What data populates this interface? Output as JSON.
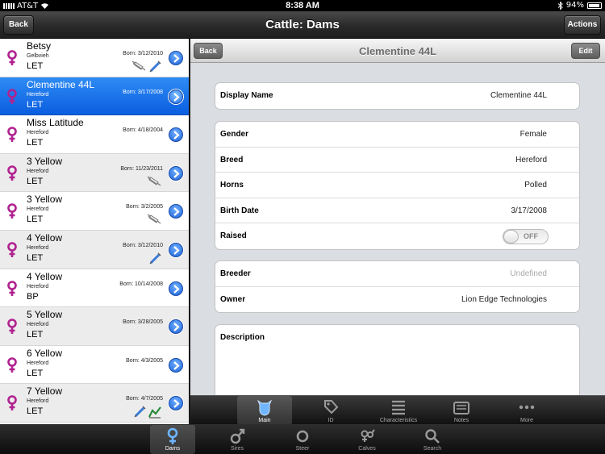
{
  "status": {
    "carrier": "AT&T",
    "time": "8:38 AM",
    "battery": "94%"
  },
  "nav": {
    "title": "Cattle: Dams",
    "back_label": "Back",
    "actions_label": "Actions"
  },
  "list": [
    {
      "name": "Betsy",
      "breed": "Gelbvieh",
      "born": "Born: 3/12/2010",
      "code": "LET",
      "icons": [
        "syringe-icon",
        "needle-icon"
      ],
      "selected": false,
      "alt": false
    },
    {
      "name": "Clementine 44L",
      "breed": "Hereford",
      "born": "Born: 3/17/2008",
      "code": "LET",
      "icons": [],
      "selected": true,
      "alt": false
    },
    {
      "name": "Miss Latitude",
      "breed": "Hereford",
      "born": "Born: 4/18/2004",
      "code": "LET",
      "icons": [],
      "selected": false,
      "alt": false
    },
    {
      "name": "3 Yellow",
      "breed": "Hereford",
      "born": "Born: 11/23/2011",
      "code": "LET",
      "icons": [
        "syringe-icon"
      ],
      "selected": false,
      "alt": true
    },
    {
      "name": "3 Yellow",
      "breed": "Hereford",
      "born": "Born: 3/2/2005",
      "code": "LET",
      "icons": [
        "syringe-icon"
      ],
      "selected": false,
      "alt": false
    },
    {
      "name": "4 Yellow",
      "breed": "Hereford",
      "born": "Born: 3/12/2010",
      "code": "LET",
      "icons": [
        "needle-icon"
      ],
      "selected": false,
      "alt": true
    },
    {
      "name": "4 Yellow",
      "breed": "Hereford",
      "born": "Born: 10/14/2008",
      "code": "BP",
      "icons": [],
      "selected": false,
      "alt": false
    },
    {
      "name": "5 Yellow",
      "breed": "Hereford",
      "born": "Born: 3/28/2005",
      "code": "LET",
      "icons": [],
      "selected": false,
      "alt": true
    },
    {
      "name": "6 Yellow",
      "breed": "Hereford",
      "born": "Born: 4/3/2005",
      "code": "LET",
      "icons": [],
      "selected": false,
      "alt": false
    },
    {
      "name": "7 Yellow",
      "breed": "Hereford",
      "born": "Born: 4/7/2005",
      "code": "LET",
      "icons": [
        "needle-icon",
        "chart-icon"
      ],
      "selected": false,
      "alt": true
    }
  ],
  "detail": {
    "back_label": "Back",
    "title": "Clementine 44L",
    "edit_label": "Edit",
    "display_name_label": "Display Name",
    "display_name": "Clementine 44L",
    "gender_label": "Gender",
    "gender": "Female",
    "breed_label": "Breed",
    "breed": "Hereford",
    "horns_label": "Horns",
    "horns": "Polled",
    "birth_label": "Birth Date",
    "birth": "3/17/2008",
    "raised_label": "Raised",
    "raised_toggle": "OFF",
    "breeder_label": "Breeder",
    "breeder": "Undefined",
    "owner_label": "Owner",
    "owner": "Lion Edge Technologies",
    "description_label": "Description"
  },
  "inner_tabs": [
    {
      "label": "Main",
      "icon": "cow-head-icon",
      "active": true
    },
    {
      "label": "ID",
      "icon": "tag-icon",
      "active": false
    },
    {
      "label": "Characteristics",
      "icon": "list-icon",
      "active": false
    },
    {
      "label": "Notes",
      "icon": "notes-icon",
      "active": false
    },
    {
      "label": "More",
      "icon": "more-icon",
      "active": false
    }
  ],
  "bottom_tabs": [
    {
      "label": "Dams",
      "icon": "female-icon",
      "active": true
    },
    {
      "label": "Sires",
      "icon": "male-icon",
      "active": false
    },
    {
      "label": "Steer",
      "icon": "circle-icon",
      "active": false
    },
    {
      "label": "Calves",
      "icon": "calves-icon",
      "active": false
    },
    {
      "label": "Search",
      "icon": "search-icon",
      "active": false
    }
  ],
  "colors": {
    "selection": "#1f73ea",
    "female": "#b0228f",
    "chevron": "#2a6fe0"
  }
}
